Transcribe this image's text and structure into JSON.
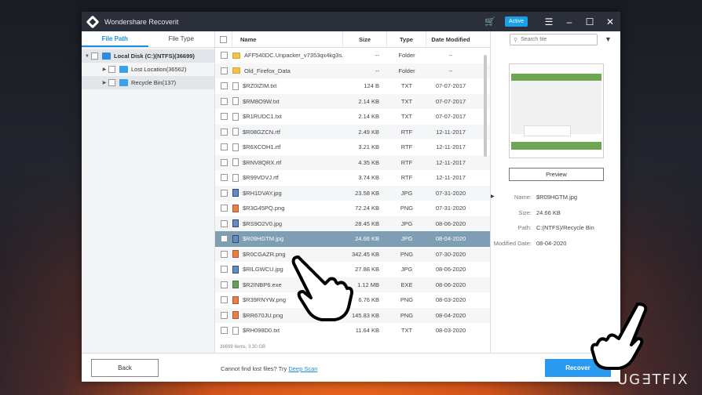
{
  "app": {
    "title": "Wondershare Recoverit",
    "active_badge": "Active"
  },
  "left_tabs": [
    "File Path",
    "File Type"
  ],
  "tree": [
    {
      "label": "Local Disk (C:)(NTFS)(36699)",
      "level": 0
    },
    {
      "label": "Lost Location(36562)",
      "level": 1
    },
    {
      "label": "Recycle Bin(137)",
      "level": 1
    }
  ],
  "table": {
    "columns": [
      "Name",
      "Size",
      "Type",
      "Date Modified"
    ],
    "rows": [
      {
        "name": "AFF540DC.Unpacker_v7353qx4kg3s...",
        "size": "--",
        "type": "Folder",
        "date": "--",
        "icon": "folder-icon"
      },
      {
        "name": "Old_Firefox_Data",
        "size": "--",
        "type": "Folder",
        "date": "--",
        "icon": "folder-icon"
      },
      {
        "name": "$RZ0IZIM.txt",
        "size": "124 B",
        "type": "TXT",
        "date": "07-07-2017",
        "icon": "txt-file-icon"
      },
      {
        "name": "$RM8O9W.txt",
        "size": "2.14 KB",
        "type": "TXT",
        "date": "07-07-2017",
        "icon": "txt-file-icon"
      },
      {
        "name": "$R1RUDC1.txt",
        "size": "2.14 KB",
        "type": "TXT",
        "date": "07-07-2017",
        "icon": "txt-file-icon"
      },
      {
        "name": "$R08GZCN.rtf",
        "size": "2.49 KB",
        "type": "RTF",
        "date": "12-11-2017",
        "icon": "rtf-file-icon"
      },
      {
        "name": "$R6XCOH1.rtf",
        "size": "3.21 KB",
        "type": "RTF",
        "date": "12-11-2017",
        "icon": "rtf-file-icon"
      },
      {
        "name": "$RNV8QRX.rtf",
        "size": "4.35 KB",
        "type": "RTF",
        "date": "12-11-2017",
        "icon": "rtf-file-icon"
      },
      {
        "name": "$R99VDVJ.rtf",
        "size": "3.74 KB",
        "type": "RTF",
        "date": "12-11-2017",
        "icon": "rtf-file-icon"
      },
      {
        "name": "$RH1DVAY.jpg",
        "size": "23.58 KB",
        "type": "JPG",
        "date": "07-31-2020",
        "icon": "jpg-file-icon"
      },
      {
        "name": "$R3G45PQ.png",
        "size": "72.24 KB",
        "type": "PNG",
        "date": "07-31-2020",
        "icon": "png-file-icon"
      },
      {
        "name": "$RS9O2V0.jpg",
        "size": "28.45 KB",
        "type": "JPG",
        "date": "08-06-2020",
        "icon": "jpg-file-icon"
      },
      {
        "name": "$R09HGTM.jpg",
        "size": "24.66 KB",
        "type": "JPG",
        "date": "08-04-2020",
        "icon": "jpg-file-icon",
        "selected": true
      },
      {
        "name": "$R0CGAZR.png",
        "size": "342.45 KB",
        "type": "PNG",
        "date": "07-30-2020",
        "icon": "png-file-icon"
      },
      {
        "name": "$RILGWCU.jpg",
        "size": "27.88 KB",
        "type": "JPG",
        "date": "08-06-2020",
        "icon": "jpg-file-icon"
      },
      {
        "name": "$R2INBP6.exe",
        "size": "1.12 MB",
        "type": "EXE",
        "date": "08-06-2020",
        "icon": "exe-file-icon"
      },
      {
        "name": "$R39RNYW.png",
        "size": "6.76 KB",
        "type": "PNG",
        "date": "08-03-2020",
        "icon": "png-file-icon"
      },
      {
        "name": "$RR670JU.png",
        "size": "145.83 KB",
        "type": "PNG",
        "date": "08-04-2020",
        "icon": "png-file-icon"
      },
      {
        "name": "$RH098D0.txt",
        "size": "11.64 KB",
        "type": "TXT",
        "date": "08-03-2020",
        "icon": "txt-file-icon"
      }
    ],
    "footer": "36699 items, 3.30 GB"
  },
  "search": {
    "placeholder": "Search file"
  },
  "preview": {
    "button": "Preview",
    "meta": [
      {
        "key": "Name:",
        "value": "$R09HGTM.jpg"
      },
      {
        "key": "Size:",
        "value": "24.66 KB"
      },
      {
        "key": "Path:",
        "value": "C:(NTFS)/Recycle Bin"
      },
      {
        "key": "Modified Date:",
        "value": "08-04-2020"
      }
    ]
  },
  "bottom": {
    "back": "Back",
    "cannot_find": "Cannot find lost files? Try",
    "deep_scan": "Deep Scan",
    "recover": "Recover"
  },
  "watermark": "UG∃TFIX"
}
